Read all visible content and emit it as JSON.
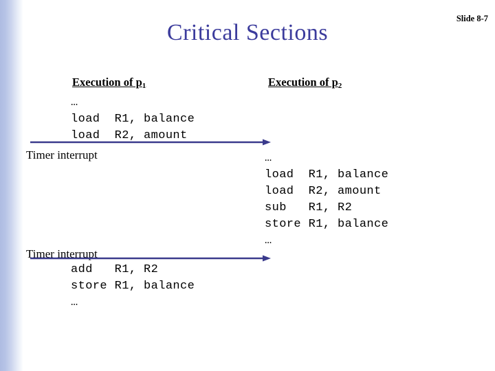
{
  "slide": {
    "title": "Critical Sections",
    "slide_number": "Slide 8-7",
    "title_color": "#3b3b9c",
    "arrow_color": "#3a3a8c",
    "stripe_color": "#aebce2"
  },
  "columns": {
    "left": {
      "header_text": "Execution of p",
      "header_subscript": "1",
      "code_top": "…\nload  R1, balance\nload  R2, amount",
      "code_bottom": "add   R1, R2\nstore R1, balance\n…"
    },
    "right": {
      "header_text": "Execution of p",
      "header_subscript": "2",
      "code": "…\nload  R1, balance\nload  R2, amount\nsub   R1, R2\nstore R1, balance\n…"
    }
  },
  "events": {
    "timer_interrupt_1": "Timer interrupt",
    "timer_interrupt_2": "Timer interrupt"
  },
  "arrows": [
    {
      "name": "switch-to-p2",
      "label": ""
    },
    {
      "name": "switch-to-p1",
      "label": ""
    }
  ]
}
